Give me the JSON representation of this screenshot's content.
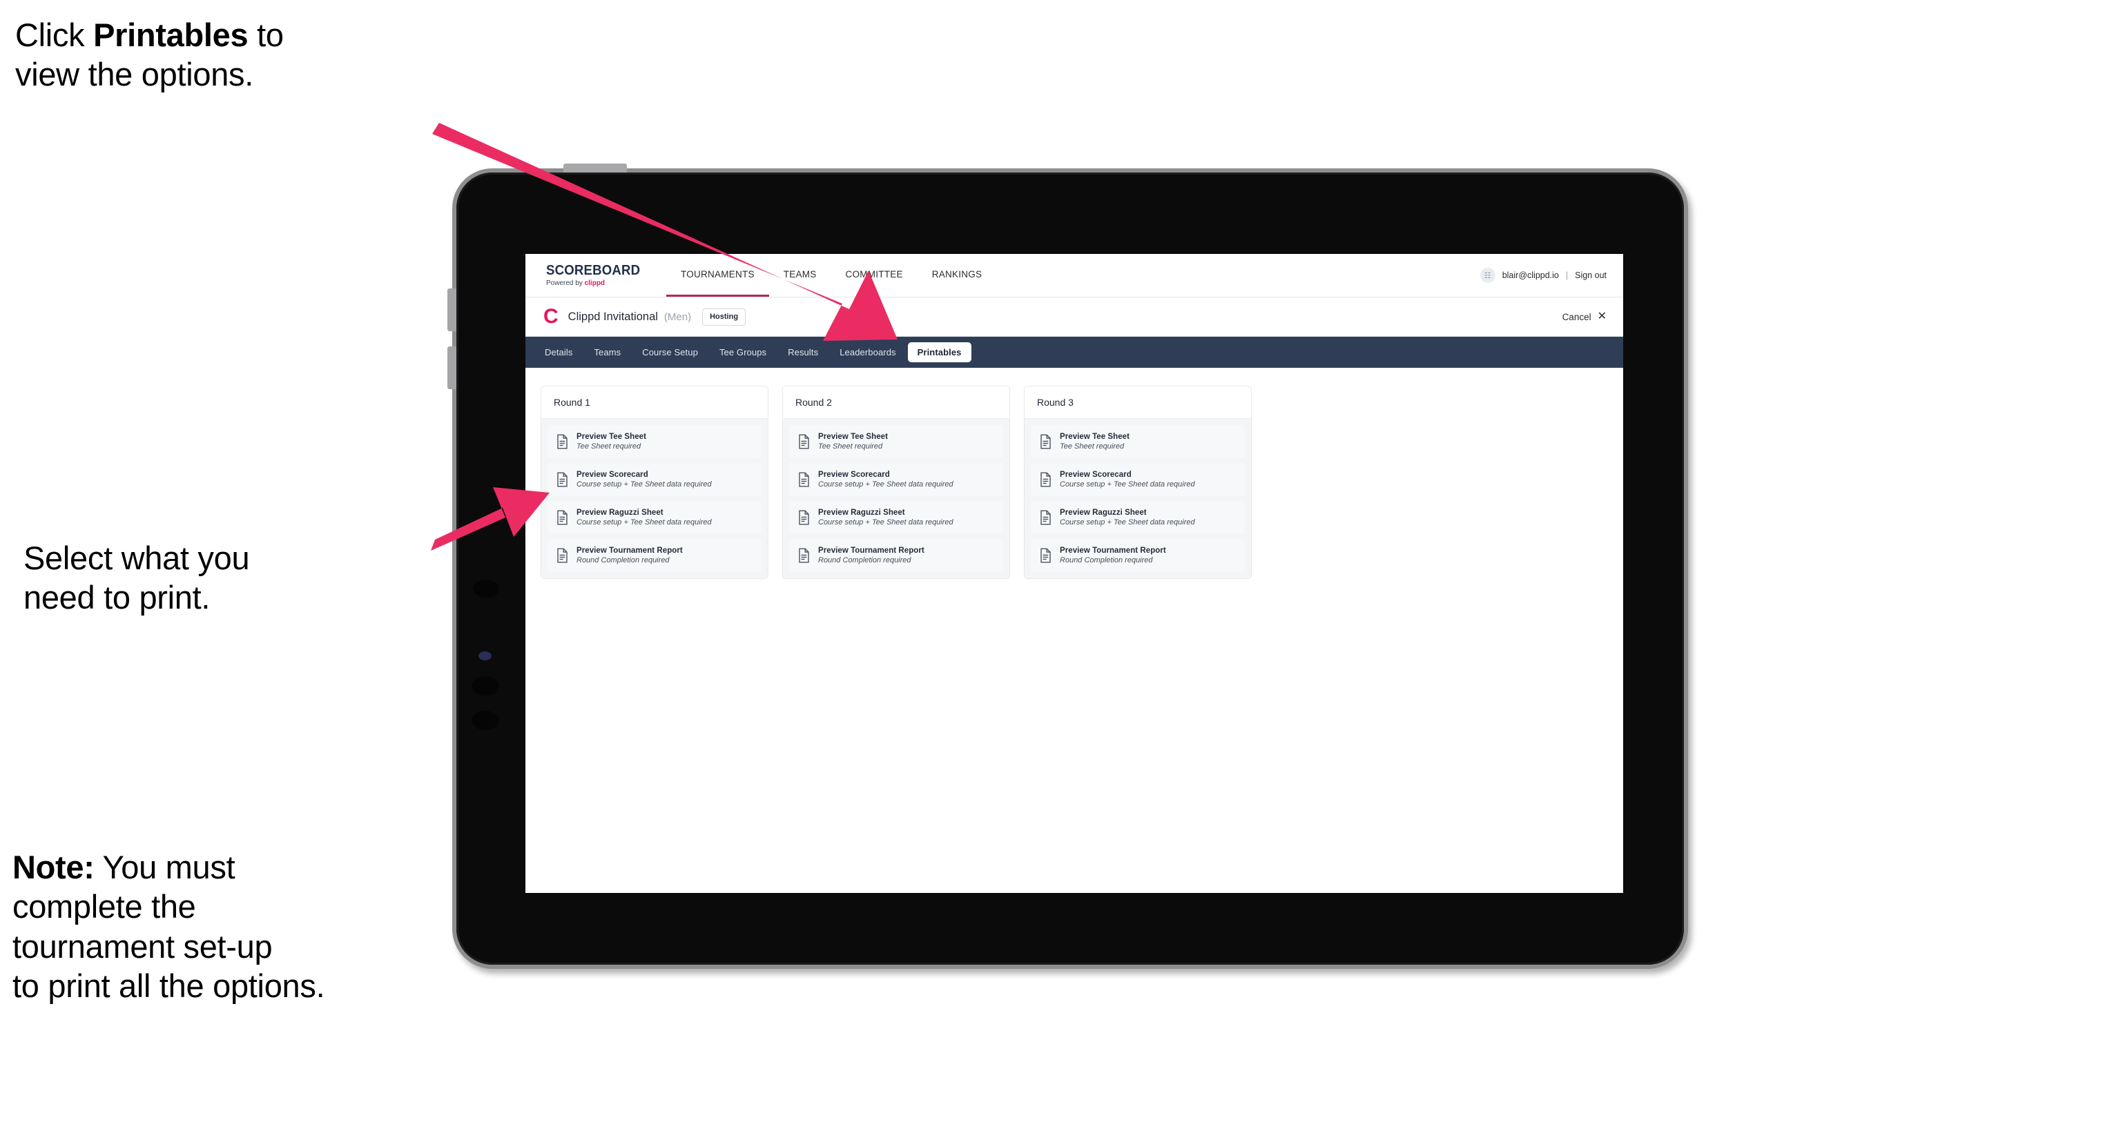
{
  "annotations": [
    {
      "id": "annot-1",
      "prefix": "Click ",
      "bold": "Printables",
      "suffix": " to\nview the options."
    },
    {
      "id": "annot-2",
      "text": "Select what you\n need to print."
    },
    {
      "id": "annot-3",
      "prefix": "",
      "bold": "Note:",
      "suffix": " You must\ncomplete the\ntournament set-up\nto print all the options."
    }
  ],
  "app": {
    "brand": {
      "title": "SCOREBOARD",
      "powered_prefix": "Powered by ",
      "powered_name": "clippd"
    },
    "topnav": [
      {
        "label": "TOURNAMENTS",
        "active": true
      },
      {
        "label": "TEAMS",
        "active": false
      },
      {
        "label": "COMMITTEE",
        "active": false
      },
      {
        "label": "RANKINGS",
        "active": false
      }
    ],
    "account": {
      "avatar_glyph": "☷",
      "email": "blair@clippd.io",
      "separator": "|",
      "sign_out": "Sign out"
    },
    "tournament": {
      "logo_letter": "C",
      "name": "Clippd Invitational",
      "gender": "(Men)",
      "badge": "Hosting",
      "cancel_label": "Cancel",
      "cancel_icon": "✕"
    },
    "tabs": [
      {
        "label": "Details",
        "active": false
      },
      {
        "label": "Teams",
        "active": false
      },
      {
        "label": "Course Setup",
        "active": false
      },
      {
        "label": "Tee Groups",
        "active": false
      },
      {
        "label": "Results",
        "active": false
      },
      {
        "label": "Leaderboards",
        "active": false
      },
      {
        "label": "Printables",
        "active": true
      }
    ],
    "rounds": [
      {
        "header": "Round 1",
        "items": [
          {
            "title": "Preview Tee Sheet",
            "sub": "Tee Sheet required",
            "icon": "document-icon"
          },
          {
            "title": "Preview Scorecard",
            "sub": "Course setup + Tee Sheet data required",
            "icon": "document-icon"
          },
          {
            "title": "Preview Raguzzi Sheet",
            "sub": "Course setup + Tee Sheet data required",
            "icon": "document-icon"
          },
          {
            "title": "Preview Tournament Report",
            "sub": "Round Completion required",
            "icon": "document-icon"
          }
        ]
      },
      {
        "header": "Round 2",
        "items": [
          {
            "title": "Preview Tee Sheet",
            "sub": "Tee Sheet required",
            "icon": "document-icon"
          },
          {
            "title": "Preview Scorecard",
            "sub": "Course setup + Tee Sheet data required",
            "icon": "document-icon"
          },
          {
            "title": "Preview Raguzzi Sheet",
            "sub": "Course setup + Tee Sheet data required",
            "icon": "document-icon"
          },
          {
            "title": "Preview Tournament Report",
            "sub": "Round Completion required",
            "icon": "document-icon"
          }
        ]
      },
      {
        "header": "Round 3",
        "items": [
          {
            "title": "Preview Tee Sheet",
            "sub": "Tee Sheet required",
            "icon": "document-icon"
          },
          {
            "title": "Preview Scorecard",
            "sub": "Course setup + Tee Sheet data required",
            "icon": "document-icon"
          },
          {
            "title": "Preview Raguzzi Sheet",
            "sub": "Course setup + Tee Sheet data required",
            "icon": "document-icon"
          },
          {
            "title": "Preview Tournament Report",
            "sub": "Round Completion required",
            "icon": "document-icon"
          }
        ]
      }
    ]
  },
  "colors": {
    "accent_pink": "#e5135a",
    "arrow_pink": "#ea2c63",
    "tabstrip_navy": "#2f3e56",
    "brand_navy": "#21304a"
  }
}
